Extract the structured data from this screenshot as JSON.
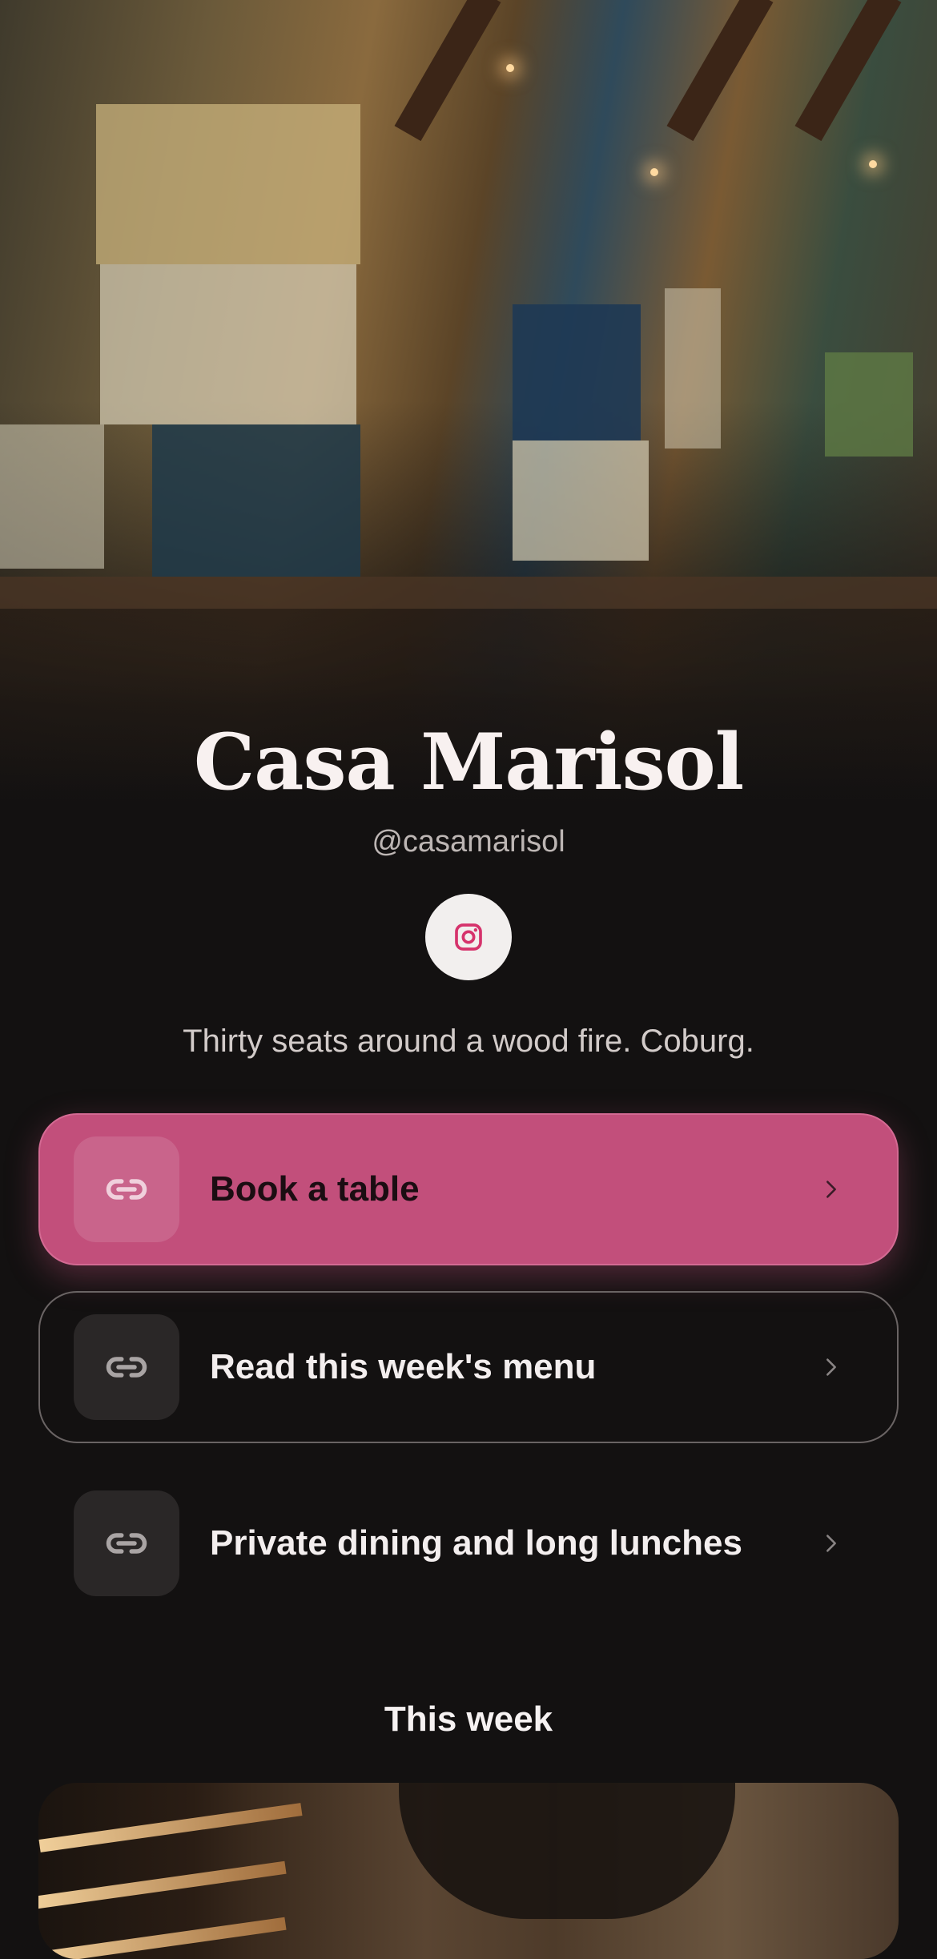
{
  "profile": {
    "name": "Casa Marisol",
    "handle": "@casamarisol",
    "bio": "Thirty seats around a wood fire. Coburg.",
    "social_icon": "instagram-icon"
  },
  "links": [
    {
      "label": "Book a table",
      "icon": "link-icon",
      "style": "primary"
    },
    {
      "label": "Read this week's menu",
      "icon": "link-icon",
      "style": "outline"
    },
    {
      "label": "Private dining and long lunches",
      "icon": "link-icon",
      "style": "plain"
    }
  ],
  "section": {
    "title": "This week"
  },
  "colors": {
    "accent": "#c24f7b",
    "background": "#131111",
    "instagram": "#d6336c"
  }
}
